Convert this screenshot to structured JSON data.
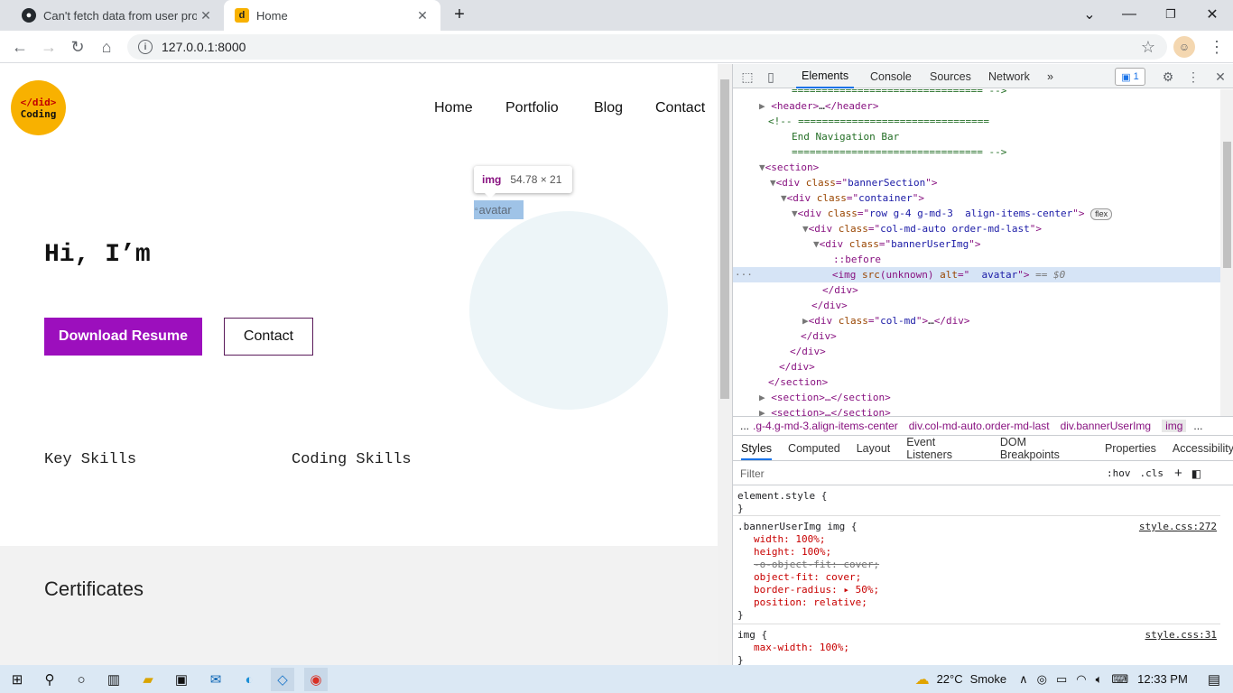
{
  "browser": {
    "tabs": [
      {
        "title": "Can't fetch data from user profile",
        "favicon": "github-icon",
        "active": false
      },
      {
        "title": "Home",
        "favicon": "d-letter-icon",
        "active": true
      }
    ],
    "new_tab_glyph": "+",
    "url": "127.0.0.1:8000"
  },
  "page": {
    "logo": {
      "line1": "</did>",
      "line2": "Coding"
    },
    "nav": [
      "Home",
      "Portfolio",
      "Blog",
      "Contact"
    ],
    "tooltip": {
      "tag": "img",
      "size": "54.78 × 21"
    },
    "avatar_alt": "avatar",
    "greeting": "Hi, I’m",
    "download_button": "Download Resume",
    "contact_button": "Contact",
    "key_skills": "Key Skills",
    "coding_skills": "Coding Skills",
    "certificates": "Certificates"
  },
  "devtools": {
    "tabs": [
      "Elements",
      "Console",
      "Sources",
      "Network"
    ],
    "more": "»",
    "issues_count": "1",
    "dom_lines": {
      "l0": "================================ -->",
      "l1_open": "<header>",
      "l1_close": "</header>",
      "l2": "<!-- ================================",
      "l3": "End Navigation Bar",
      "l4": "================================ -->",
      "l5": "<section>",
      "l6_class": "bannerSection",
      "l7_class": "container",
      "l8_class": "row g-4 g-md-3  align-items-center",
      "l8_pill": "flex",
      "l9_class": "col-md-auto order-md-last",
      "l10_class": "bannerUserImg",
      "l11": "::before",
      "l12_src": "(unknown)",
      "l12_alt": "  avatar",
      "l12_marker": "== $0",
      "l13": "</div>",
      "l14": "</div>",
      "l15_class": "col-md",
      "l16": "</div>",
      "l17": "</div>",
      "l18": "</div>",
      "l19": "</section>",
      "l20": "<section>…</section>",
      "l21": "<section>…</section>"
    },
    "breadcrumbs": [
      "...",
      ".g-4.g-md-3.align-items-center",
      "div.col-md-auto.order-md-last",
      "div.bannerUserImg",
      "img",
      "..."
    ],
    "styles_tabs": [
      "Styles",
      "Computed",
      "Layout",
      "Event Listeners",
      "DOM Breakpoints",
      "Properties",
      "Accessibility"
    ],
    "filter_placeholder": "Filter",
    "hov": ":hov",
    "cls": ".cls",
    "rules": {
      "element_style": "element.style {",
      "close": "}",
      "rule1_selector": ".bannerUserImg img {",
      "rule1_source": "style.css:272",
      "rule1_width": "width: 100%;",
      "rule1_height": "height: 100%;",
      "rule1_struck": "-o-object-fit: cover;",
      "rule1_fit": "object-fit: cover;",
      "rule1_radius": "border-radius: ▸ 50%;",
      "rule1_position": "position: relative;",
      "rule2_selector": "img {",
      "rule2_source": "style.css:31",
      "rule2_maxwidth": "max-width: 100%;"
    }
  },
  "taskbar": {
    "temperature": "22°C",
    "weather": "Smoke",
    "time": "12:33 PM"
  },
  "colors": {
    "accent_purple": "#9c0fbd",
    "logo_yellow": "#f8b100",
    "highlight_blue": "#d6e4f6"
  }
}
